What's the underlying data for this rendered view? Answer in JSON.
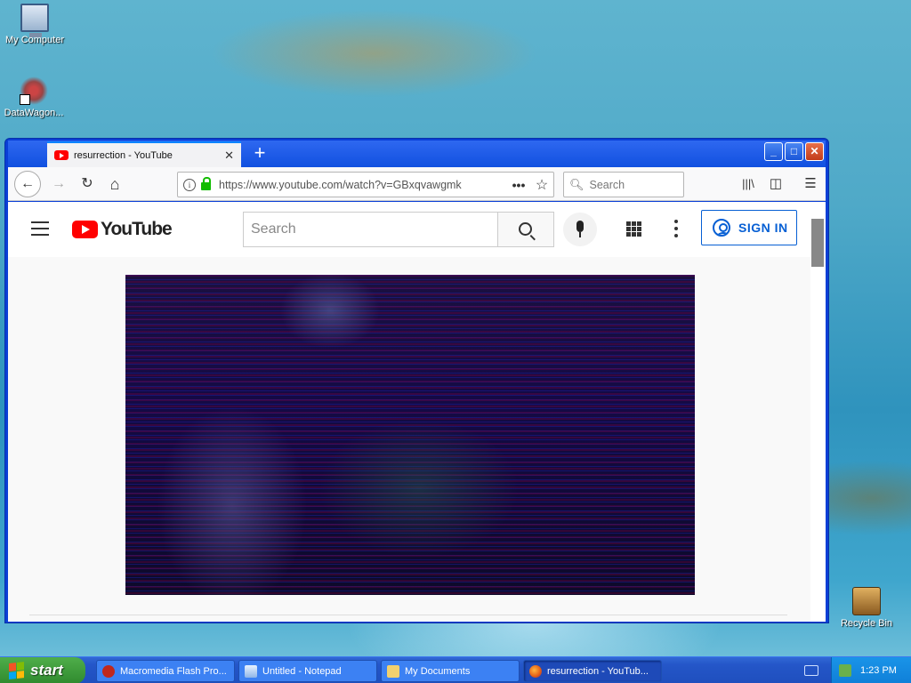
{
  "desktop": {
    "icons": [
      {
        "label": "My Computer"
      },
      {
        "label": "DataWagon..."
      },
      {
        "label": "Recycle Bin"
      }
    ]
  },
  "browser": {
    "tab": {
      "title": "resurrection - YouTube",
      "close": "✕"
    },
    "newtab": "+",
    "window_buttons": {
      "minimize": "_",
      "maximize": "□",
      "close": "✕"
    },
    "nav": {
      "back": "←",
      "forward": "→",
      "reload": "↻",
      "home": "⌂"
    },
    "url": "https://www.youtube.com/watch?v=GBxqvawgmk",
    "url_actions": {
      "more": "•••",
      "bookmark": "☆"
    },
    "search_placeholder": "Search",
    "toolbar": {
      "library": "|||\\",
      "sidebar": "◫",
      "menu": "☰"
    }
  },
  "youtube": {
    "logo_text": "YouTube",
    "search_placeholder": "Search",
    "signin_label": "SIGN IN"
  },
  "taskbar": {
    "start_label": "start",
    "tasks": [
      {
        "label": "Macromedia Flash Pro...",
        "icon": "flash-icon"
      },
      {
        "label": "Untitled - Notepad",
        "icon": "notepad-icon"
      },
      {
        "label": "My Documents",
        "icon": "folder-icon"
      },
      {
        "label": "resurrection - YouTub...",
        "icon": "firefox-icon"
      }
    ],
    "clock": "1:23 PM"
  },
  "colors": {
    "youtube_red": "#ff0000",
    "signin_blue": "#065fd4",
    "xp_blue": "#2456c8",
    "start_green": "#3a9a38"
  }
}
